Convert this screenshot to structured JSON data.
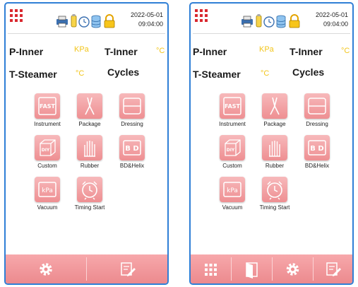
{
  "status": {
    "date": "2022-05-01",
    "time": "09:04:00",
    "icons": [
      "printer-icon",
      "usb-icon",
      "timer-icon",
      "database-icon",
      "lock-icon"
    ]
  },
  "params": {
    "p_inner_label": "P-Inner",
    "p_inner_unit": "KPa",
    "t_inner_label": "T-Inner",
    "t_inner_unit": "°C",
    "t_steamer_label": "T-Steamer",
    "t_steamer_unit": "°C",
    "cycles_label": "Cycles"
  },
  "programs": [
    {
      "label": "Instrument",
      "icon": "fast-icon",
      "glyph": "FAST"
    },
    {
      "label": "Package",
      "icon": "tweezers-icon"
    },
    {
      "label": "Dressing",
      "icon": "dressing-icon"
    },
    {
      "label": "Custom",
      "icon": "diy-box-icon",
      "glyph": "DIY"
    },
    {
      "label": "Rubber",
      "icon": "glove-icon"
    },
    {
      "label": "BD&Helix",
      "icon": "bd-icon",
      "glyph": "B D"
    },
    {
      "label": "Vacuum",
      "icon": "kpa-icon",
      "glyph": "kPa"
    },
    {
      "label": "Timing Start",
      "icon": "alarm-clock-icon"
    }
  ],
  "toolbar_left": [
    "settings-gear-icon",
    "edit-log-icon"
  ],
  "toolbar_right": [
    "menu-grid-icon",
    "door-icon",
    "settings-gear-icon",
    "edit-log-icon"
  ],
  "colors": {
    "frame": "#2f7fd6",
    "accent": "#ee8f92",
    "unit": "#f2c51b",
    "grid_icon": "#d9282f"
  }
}
